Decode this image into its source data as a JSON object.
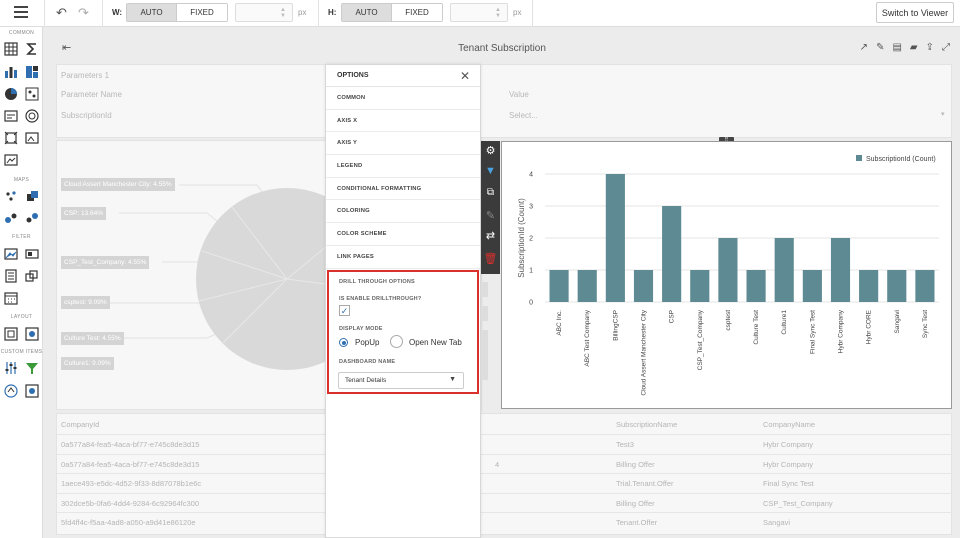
{
  "toolbar": {
    "width_label": "W:",
    "height_label": "H:",
    "auto": "AUTO",
    "fixed": "FIXED",
    "px": "px",
    "switch_button": "Switch to Viewer"
  },
  "leftbar": {
    "sections": [
      "COMMON",
      "MAPS",
      "FILTER",
      "LAYOUT",
      "CUSTOM ITEMS"
    ]
  },
  "dashboard": {
    "title": "Tenant Subscription"
  },
  "filter_panel": {
    "title": "Parameters 1",
    "col1_header": "Parameter Name",
    "col2_header": "Value",
    "param_name": "SubscriptionId",
    "param_value_placeholder": "Select..."
  },
  "pie_labels": [
    "Cloud Assert Manchester City: 4.55%",
    "CSP: 13.64%",
    "CSP_Test_Company: 4.55%",
    "csptest: 9.09%",
    "Culture Test: 4.55%",
    "Culture1: 9.09%"
  ],
  "options": {
    "title": "OPTIONS",
    "items": [
      "COMMON",
      "AXIS X",
      "AXIS Y",
      "LEGEND",
      "CONDITIONAL FORMATTING",
      "COLORING",
      "COLOR SCHEME",
      "LINK PAGES"
    ],
    "drill": {
      "title": "DRILL THROUGH OPTIONS",
      "enable_label": "IS ENABLE DRILLTHROUGH?",
      "enabled": true,
      "display_mode_label": "DISPLAY MODE",
      "popup": "PopUp",
      "new_tab": "Open New Tab",
      "dashboard_name_label": "DASHBOARD NAME",
      "dashboard_name": "Tenant Details"
    }
  },
  "grid": {
    "headers": [
      "CompanyId",
      "SubscriptionName",
      "CompanyName"
    ],
    "rows": [
      [
        "0a577a84-fea5-4aca-bf77-e745c8de3d15",
        "Test3",
        "Hybr Company"
      ],
      [
        "0a577a84-fea5-4aca-bf77-e745c8de3d15",
        "Billing Offer",
        "Hybr Company"
      ],
      [
        "1aece493-e5dc-4d52-9f33-8d87078b1e6c",
        "Trial.Tenant.Offer",
        "Final Sync Test"
      ],
      [
        "302dce5b-0fa6-4dd4-9284-6c92964fc300",
        "Billing Offer",
        "CSP_Test_Company"
      ],
      [
        "5fd4ff4c-f5aa-4ad8-a050-a9d41e86120e",
        "Tenant.Offer",
        "Sangavi"
      ]
    ],
    "stray_digit": "4"
  },
  "chart_data": {
    "type": "bar",
    "categories": [
      "ABC Inc.",
      "ABC Test Company",
      "BillingCSP",
      "Cloud Assert Manchester City",
      "CSP",
      "CSP_Test_Company",
      "csptest",
      "Culture Test",
      "Culture1",
      "Final Sync Test",
      "Hybr Company",
      "Hybr CORE",
      "Sangavi",
      "Sync Test"
    ],
    "series": [
      {
        "name": "SubscriptionId (Count)",
        "values": [
          1,
          1,
          4,
          1,
          3,
          1,
          2,
          1,
          2,
          1,
          2,
          1,
          1,
          1
        ]
      }
    ],
    "ylabel": "SubscriptionId (Count)",
    "xlabel": "",
    "ylim": [
      0,
      4
    ],
    "yticks": [
      "0",
      "1",
      "2",
      "3",
      "4"
    ],
    "grid": true,
    "legend": "top-right",
    "color": "#5e8a93"
  }
}
